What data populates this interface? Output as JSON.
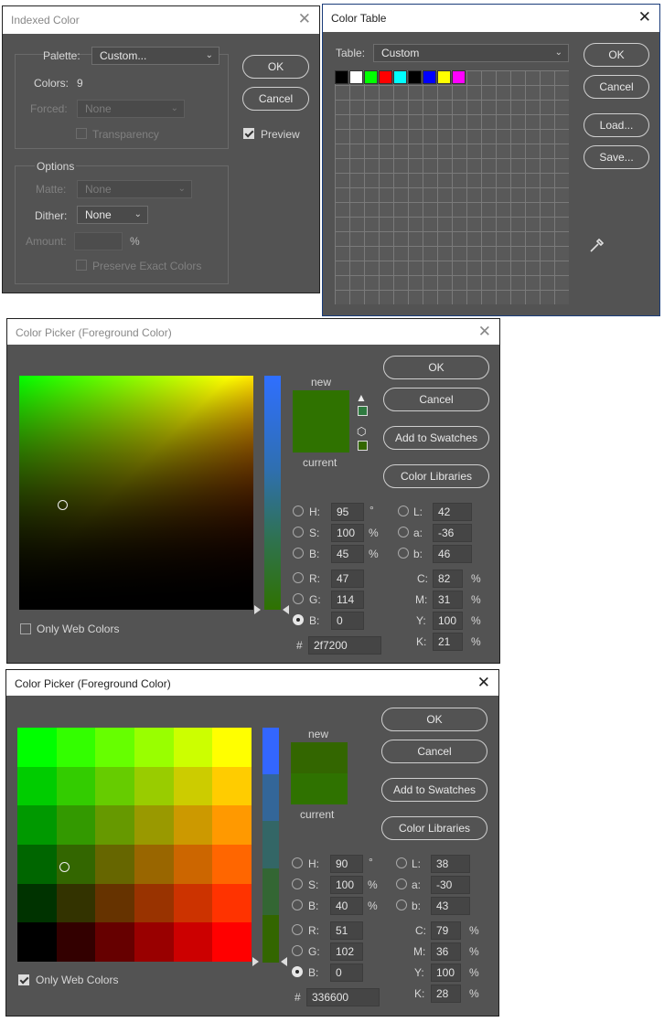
{
  "indexed": {
    "title": "Indexed Color",
    "palette_label": "Palette:",
    "palette_value": "Custom...",
    "colors_label": "Colors:",
    "colors_value": "9",
    "forced_label": "Forced:",
    "forced_value": "None",
    "transparency_label": "Transparency",
    "options_label": "Options",
    "matte_label": "Matte:",
    "matte_value": "None",
    "dither_label": "Dither:",
    "dither_value": "None",
    "amount_label": "Amount:",
    "amount_unit": "%",
    "preserve_label": "Preserve Exact Colors",
    "ok": "OK",
    "cancel": "Cancel",
    "preview_label": "Preview"
  },
  "colortable": {
    "title": "Color Table",
    "table_label": "Table:",
    "table_value": "Custom",
    "swatches": [
      "#000000",
      "#ffffff",
      "#00ff00",
      "#ff0000",
      "#00ffff",
      "#000000",
      "#0000ff",
      "#ffff00",
      "#ff00ff"
    ],
    "ok": "OK",
    "cancel": "Cancel",
    "load": "Load...",
    "save": "Save..."
  },
  "picker1": {
    "title": "Color Picker (Foreground Color)",
    "new_label": "new",
    "current_label": "current",
    "new_color": "#2f7200",
    "current_color": "#2f7200",
    "ok": "OK",
    "cancel": "Cancel",
    "add_swatches": "Add to Swatches",
    "color_libraries": "Color Libraries",
    "only_web_label": "Only Web Colors",
    "only_web_checked": false,
    "H": "95",
    "S": "100",
    "Bv": "45",
    "R": "47",
    "G": "114",
    "Bb": "0",
    "L": "42",
    "a": "-36",
    "b": "46",
    "C": "82",
    "M": "31",
    "Y": "100",
    "K": "21",
    "hex": "2f7200",
    "deg": "°",
    "pct": "%",
    "hash": "#"
  },
  "picker2": {
    "title": "Color Picker (Foreground Color)",
    "new_label": "new",
    "current_label": "current",
    "new_color": "#336600",
    "current_color": "#2f7200",
    "ok": "OK",
    "cancel": "Cancel",
    "add_swatches": "Add to Swatches",
    "color_libraries": "Color Libraries",
    "only_web_label": "Only Web Colors",
    "only_web_checked": true,
    "H": "90",
    "S": "100",
    "Bv": "40",
    "R": "51",
    "G": "102",
    "Bb": "0",
    "L": "38",
    "a": "-30",
    "b": "43",
    "C": "79",
    "M": "36",
    "Y": "100",
    "K": "28",
    "hex": "336600",
    "deg": "°",
    "pct": "%",
    "hash": "#",
    "web_grid_colors": [
      [
        "#00ff00",
        "#33ff00",
        "#66ff00",
        "#99ff00",
        "#ccff00",
        "#ffff00"
      ],
      [
        "#00cc00",
        "#33cc00",
        "#66cc00",
        "#99cc00",
        "#cccc00",
        "#ffcc00"
      ],
      [
        "#009900",
        "#339900",
        "#669900",
        "#999900",
        "#cc9900",
        "#ff9900"
      ],
      [
        "#006600",
        "#336600",
        "#666600",
        "#996600",
        "#cc6600",
        "#ff6600"
      ],
      [
        "#003300",
        "#333300",
        "#663300",
        "#993300",
        "#cc3300",
        "#ff3300"
      ],
      [
        "#000000",
        "#330000",
        "#660000",
        "#990000",
        "#cc0000",
        "#ff0000"
      ]
    ],
    "hue_strip_colors": [
      "#3366ff",
      "#336699",
      "#336666",
      "#336633",
      "#336600"
    ]
  },
  "labels": {
    "H": "H:",
    "S": "S:",
    "B": "B:",
    "R": "R:",
    "G": "G:",
    "L": "L:",
    "a": "a:",
    "b": "b:",
    "C": "C:",
    "M": "M:",
    "Y": "Y:",
    "K": "K:"
  }
}
